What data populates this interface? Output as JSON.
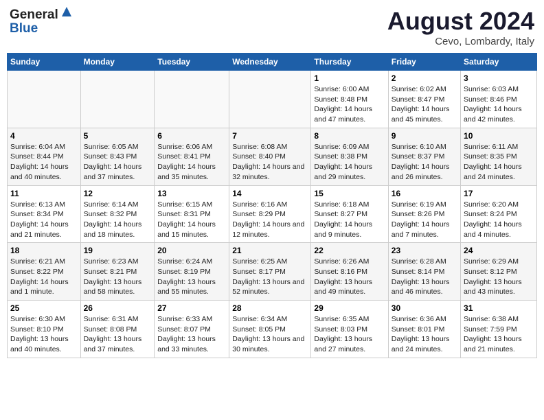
{
  "logo": {
    "general": "General",
    "blue": "Blue"
  },
  "title": "August 2024",
  "subtitle": "Cevo, Lombardy, Italy",
  "days_header": [
    "Sunday",
    "Monday",
    "Tuesday",
    "Wednesday",
    "Thursday",
    "Friday",
    "Saturday"
  ],
  "weeks": [
    [
      {
        "num": "",
        "sunrise": "",
        "sunset": "",
        "daylight": ""
      },
      {
        "num": "",
        "sunrise": "",
        "sunset": "",
        "daylight": ""
      },
      {
        "num": "",
        "sunrise": "",
        "sunset": "",
        "daylight": ""
      },
      {
        "num": "",
        "sunrise": "",
        "sunset": "",
        "daylight": ""
      },
      {
        "num": "1",
        "sunrise": "Sunrise: 6:00 AM",
        "sunset": "Sunset: 8:48 PM",
        "daylight": "Daylight: 14 hours and 47 minutes."
      },
      {
        "num": "2",
        "sunrise": "Sunrise: 6:02 AM",
        "sunset": "Sunset: 8:47 PM",
        "daylight": "Daylight: 14 hours and 45 minutes."
      },
      {
        "num": "3",
        "sunrise": "Sunrise: 6:03 AM",
        "sunset": "Sunset: 8:46 PM",
        "daylight": "Daylight: 14 hours and 42 minutes."
      }
    ],
    [
      {
        "num": "4",
        "sunrise": "Sunrise: 6:04 AM",
        "sunset": "Sunset: 8:44 PM",
        "daylight": "Daylight: 14 hours and 40 minutes."
      },
      {
        "num": "5",
        "sunrise": "Sunrise: 6:05 AM",
        "sunset": "Sunset: 8:43 PM",
        "daylight": "Daylight: 14 hours and 37 minutes."
      },
      {
        "num": "6",
        "sunrise": "Sunrise: 6:06 AM",
        "sunset": "Sunset: 8:41 PM",
        "daylight": "Daylight: 14 hours and 35 minutes."
      },
      {
        "num": "7",
        "sunrise": "Sunrise: 6:08 AM",
        "sunset": "Sunset: 8:40 PM",
        "daylight": "Daylight: 14 hours and 32 minutes."
      },
      {
        "num": "8",
        "sunrise": "Sunrise: 6:09 AM",
        "sunset": "Sunset: 8:38 PM",
        "daylight": "Daylight: 14 hours and 29 minutes."
      },
      {
        "num": "9",
        "sunrise": "Sunrise: 6:10 AM",
        "sunset": "Sunset: 8:37 PM",
        "daylight": "Daylight: 14 hours and 26 minutes."
      },
      {
        "num": "10",
        "sunrise": "Sunrise: 6:11 AM",
        "sunset": "Sunset: 8:35 PM",
        "daylight": "Daylight: 14 hours and 24 minutes."
      }
    ],
    [
      {
        "num": "11",
        "sunrise": "Sunrise: 6:13 AM",
        "sunset": "Sunset: 8:34 PM",
        "daylight": "Daylight: 14 hours and 21 minutes."
      },
      {
        "num": "12",
        "sunrise": "Sunrise: 6:14 AM",
        "sunset": "Sunset: 8:32 PM",
        "daylight": "Daylight: 14 hours and 18 minutes."
      },
      {
        "num": "13",
        "sunrise": "Sunrise: 6:15 AM",
        "sunset": "Sunset: 8:31 PM",
        "daylight": "Daylight: 14 hours and 15 minutes."
      },
      {
        "num": "14",
        "sunrise": "Sunrise: 6:16 AM",
        "sunset": "Sunset: 8:29 PM",
        "daylight": "Daylight: 14 hours and 12 minutes."
      },
      {
        "num": "15",
        "sunrise": "Sunrise: 6:18 AM",
        "sunset": "Sunset: 8:27 PM",
        "daylight": "Daylight: 14 hours and 9 minutes."
      },
      {
        "num": "16",
        "sunrise": "Sunrise: 6:19 AM",
        "sunset": "Sunset: 8:26 PM",
        "daylight": "Daylight: 14 hours and 7 minutes."
      },
      {
        "num": "17",
        "sunrise": "Sunrise: 6:20 AM",
        "sunset": "Sunset: 8:24 PM",
        "daylight": "Daylight: 14 hours and 4 minutes."
      }
    ],
    [
      {
        "num": "18",
        "sunrise": "Sunrise: 6:21 AM",
        "sunset": "Sunset: 8:22 PM",
        "daylight": "Daylight: 14 hours and 1 minute."
      },
      {
        "num": "19",
        "sunrise": "Sunrise: 6:23 AM",
        "sunset": "Sunset: 8:21 PM",
        "daylight": "Daylight: 13 hours and 58 minutes."
      },
      {
        "num": "20",
        "sunrise": "Sunrise: 6:24 AM",
        "sunset": "Sunset: 8:19 PM",
        "daylight": "Daylight: 13 hours and 55 minutes."
      },
      {
        "num": "21",
        "sunrise": "Sunrise: 6:25 AM",
        "sunset": "Sunset: 8:17 PM",
        "daylight": "Daylight: 13 hours and 52 minutes."
      },
      {
        "num": "22",
        "sunrise": "Sunrise: 6:26 AM",
        "sunset": "Sunset: 8:16 PM",
        "daylight": "Daylight: 13 hours and 49 minutes."
      },
      {
        "num": "23",
        "sunrise": "Sunrise: 6:28 AM",
        "sunset": "Sunset: 8:14 PM",
        "daylight": "Daylight: 13 hours and 46 minutes."
      },
      {
        "num": "24",
        "sunrise": "Sunrise: 6:29 AM",
        "sunset": "Sunset: 8:12 PM",
        "daylight": "Daylight: 13 hours and 43 minutes."
      }
    ],
    [
      {
        "num": "25",
        "sunrise": "Sunrise: 6:30 AM",
        "sunset": "Sunset: 8:10 PM",
        "daylight": "Daylight: 13 hours and 40 minutes."
      },
      {
        "num": "26",
        "sunrise": "Sunrise: 6:31 AM",
        "sunset": "Sunset: 8:08 PM",
        "daylight": "Daylight: 13 hours and 37 minutes."
      },
      {
        "num": "27",
        "sunrise": "Sunrise: 6:33 AM",
        "sunset": "Sunset: 8:07 PM",
        "daylight": "Daylight: 13 hours and 33 minutes."
      },
      {
        "num": "28",
        "sunrise": "Sunrise: 6:34 AM",
        "sunset": "Sunset: 8:05 PM",
        "daylight": "Daylight: 13 hours and 30 minutes."
      },
      {
        "num": "29",
        "sunrise": "Sunrise: 6:35 AM",
        "sunset": "Sunset: 8:03 PM",
        "daylight": "Daylight: 13 hours and 27 minutes."
      },
      {
        "num": "30",
        "sunrise": "Sunrise: 6:36 AM",
        "sunset": "Sunset: 8:01 PM",
        "daylight": "Daylight: 13 hours and 24 minutes."
      },
      {
        "num": "31",
        "sunrise": "Sunrise: 6:38 AM",
        "sunset": "Sunset: 7:59 PM",
        "daylight": "Daylight: 13 hours and 21 minutes."
      }
    ]
  ]
}
